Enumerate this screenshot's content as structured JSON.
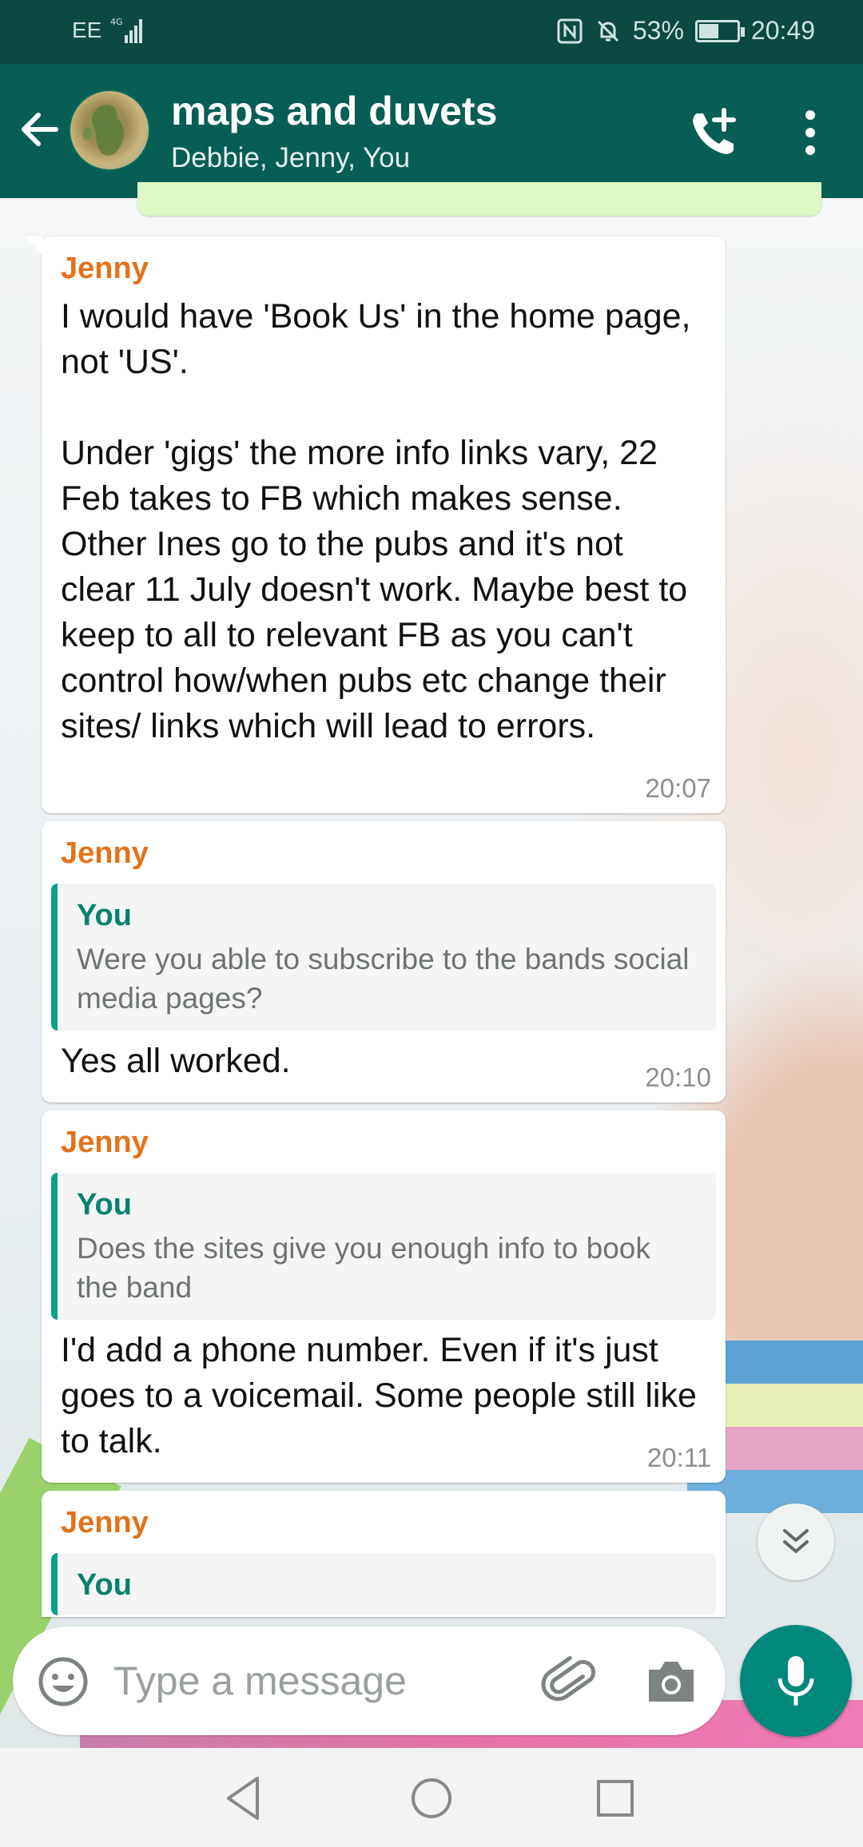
{
  "status_bar": {
    "carrier": "EE",
    "network": "4G",
    "battery": "53%",
    "battery_level": 0.53,
    "time": "20:49"
  },
  "header": {
    "title": "maps and duvets",
    "subtitle": "Debbie, Jenny, You"
  },
  "messages": [
    {
      "sender": "Jenny",
      "text": "I would have 'Book Us' in the home page, not 'US'.\n\nUnder 'gigs' the more info links vary, 22 Feb takes to FB which makes sense. Other Ines go to the pubs and it's not clear 11 July doesn't work. Maybe best to keep to all to relevant FB as you can't control how/when pubs etc change their sites/ links which will lead to errors.",
      "time": "20:07"
    },
    {
      "sender": "Jenny",
      "quote_name": "You",
      "quote_text": "Were you able to subscribe to the bands social media pages?",
      "text": "Yes all worked.",
      "time": "20:10"
    },
    {
      "sender": "Jenny",
      "quote_name": "You",
      "quote_text": "Does the sites give you enough info to book the band",
      "text": "I'd add a phone number. Even if it's just goes to a voicemail. Some people still like to talk.",
      "time": "20:11"
    },
    {
      "sender": "Jenny",
      "quote_name": "You"
    }
  ],
  "composer": {
    "placeholder": "Type a message"
  },
  "colors": {
    "header": "#075e54",
    "status_bar": "#0a4a43",
    "sender_name": "#e3721b",
    "quote_accent": "#07a189",
    "mic_button": "#00897b"
  },
  "icons": {
    "back": "arrow-left-icon",
    "call_add": "phone-add-icon",
    "menu": "more-vert-icon",
    "scroll": "double-chevron-down-icon",
    "emoji": "smiley-icon",
    "attach": "paperclip-icon",
    "camera": "camera-icon",
    "mic": "microphone-icon"
  }
}
